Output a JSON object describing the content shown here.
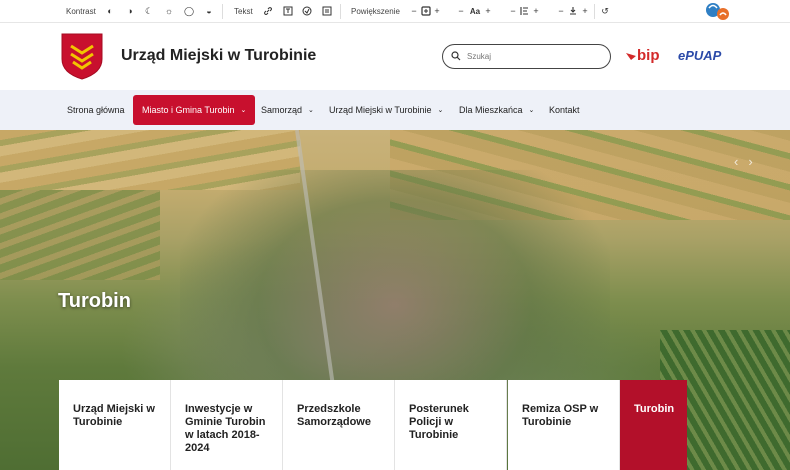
{
  "toolbar": {
    "contrast_label": "Kontrast",
    "text_label": "Tekst",
    "zoom_label": "Powiększenie",
    "font_size_glyph": "Aa"
  },
  "header": {
    "title": "Urząd Miejski w Turobinie",
    "search_placeholder": "Szukaj",
    "bip_label": "bip",
    "epuap_label": "ePUAP"
  },
  "nav": {
    "items": [
      {
        "label": "Strona główna"
      },
      {
        "label": "Miasto i Gmina Turobin"
      },
      {
        "label": "Samorząd"
      },
      {
        "label": "Urząd Miejski w Turobinie"
      },
      {
        "label": "Dla Mieszkańca"
      },
      {
        "label": "Kontakt"
      }
    ]
  },
  "hero": {
    "caption": "Turobin"
  },
  "cards": [
    {
      "label": "Urząd Miejski w Turobinie"
    },
    {
      "label": "Inwestycje w Gminie Turobin w latach 2018-2024"
    },
    {
      "label": "Przedszkole Samorządowe"
    },
    {
      "label": "Posterunek Policji w Turobinie"
    },
    {
      "label": "Remiza OSP w Turobinie"
    },
    {
      "label": "Turobin"
    }
  ],
  "colors": {
    "accent": "#c8102e",
    "nav_bg": "#eef1f8",
    "bip": "#d32a2a",
    "epuap": "#2b4aa8"
  }
}
